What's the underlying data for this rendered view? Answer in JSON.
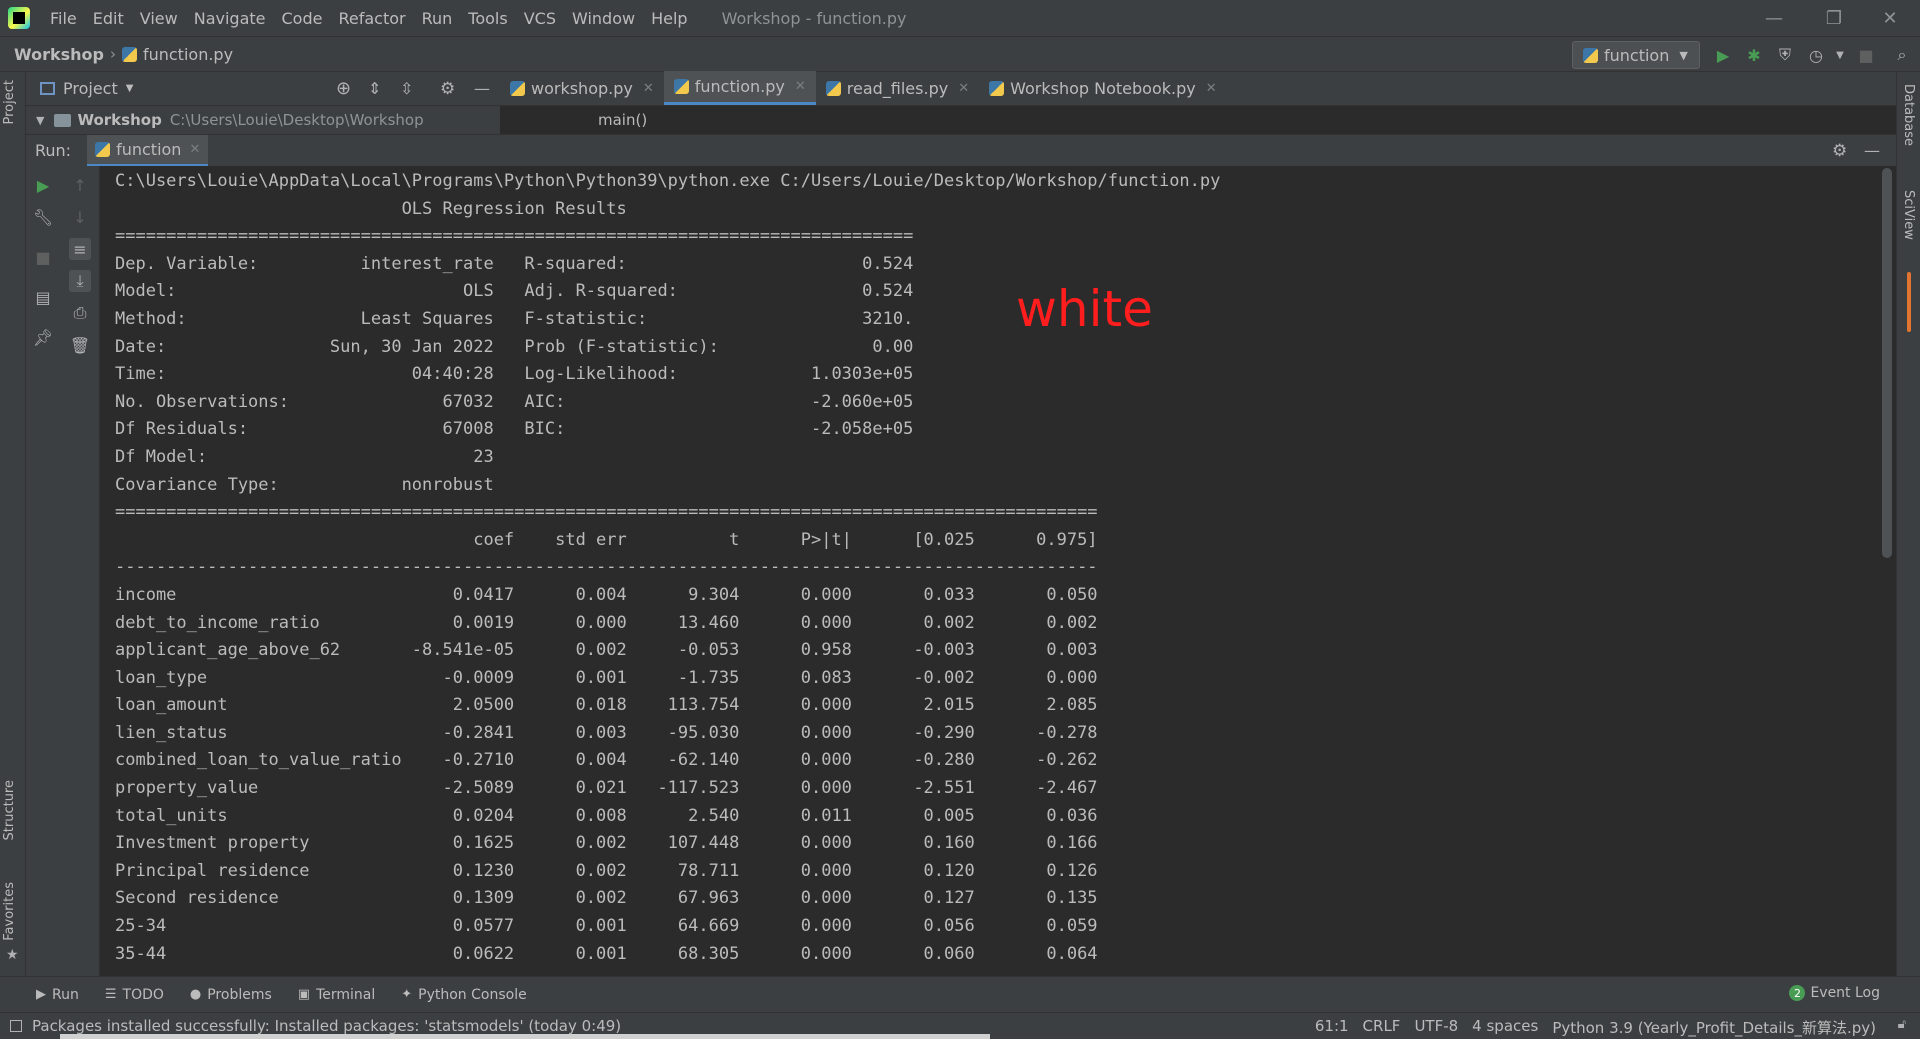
{
  "menu": {
    "items": [
      "File",
      "Edit",
      "View",
      "Navigate",
      "Code",
      "Refactor",
      "Run",
      "Tools",
      "VCS",
      "Window",
      "Help"
    ],
    "window_title": "Workshop - function.py"
  },
  "navbar": {
    "project": "Workshop",
    "file": "function.py",
    "run_config": "function"
  },
  "project_panel": {
    "title": "Project",
    "root_name": "Workshop",
    "root_path": "C:\\Users\\Louie\\Desktop\\Workshop"
  },
  "editor": {
    "tabs": [
      {
        "label": "workshop.py",
        "active": false
      },
      {
        "label": "function.py",
        "active": true
      },
      {
        "label": "read_files.py",
        "active": false
      },
      {
        "label": "Workshop Notebook.py",
        "active": false
      }
    ],
    "breadcrumb": "main()"
  },
  "run_panel": {
    "label": "Run:",
    "tab": "function"
  },
  "console": {
    "command": "C:\\Users\\Louie\\AppData\\Local\\Programs\\Python\\Python39\\python.exe C:/Users/Louie/Desktop/Workshop/function.py",
    "output": "                            OLS Regression Results                            \n==============================================================================\nDep. Variable:          interest_rate   R-squared:                       0.524\nModel:                            OLS   Adj. R-squared:                  0.524\nMethod:                 Least Squares   F-statistic:                     3210.\nDate:                Sun, 30 Jan 2022   Prob (F-statistic):               0.00\nTime:                        04:40:28   Log-Likelihood:             1.0303e+05\nNo. Observations:               67032   AIC:                        -2.060e+05\nDf Residuals:                   67008   BIC:                        -2.058e+05\nDf Model:                          23                                         \nCovariance Type:            nonrobust                                         \n================================================================================================\n                                   coef    std err          t      P>|t|      [0.025      0.975]\n------------------------------------------------------------------------------------------------\nincome                           0.0417      0.004      9.304      0.000       0.033       0.050\ndebt_to_income_ratio             0.0019      0.000     13.460      0.000       0.002       0.002\napplicant_age_above_62       -8.541e-05      0.002     -0.053      0.958      -0.003       0.003\nloan_type                       -0.0009      0.001     -1.735      0.083      -0.002       0.000\nloan_amount                      2.0500      0.018    113.754      0.000       2.015       2.085\nlien_status                     -0.2841      0.003    -95.030      0.000      -0.290      -0.278\ncombined_loan_to_value_ratio    -0.2710      0.004    -62.140      0.000      -0.280      -0.262\nproperty_value                  -2.5089      0.021   -117.523      0.000      -2.551      -2.467\ntotal_units                      0.0204      0.008      2.540      0.011       0.005       0.036\nInvestment property              0.1625      0.002    107.448      0.000       0.160       0.166\nPrincipal residence              0.1230      0.002     78.711      0.000       0.120       0.126\nSecond residence                 0.1309      0.002     67.963      0.000       0.127       0.135\n25-34                            0.0577      0.001     64.669      0.000       0.056       0.059\n35-44                            0.0622      0.001     68.305      0.000       0.060       0.064",
    "annotation": "white"
  },
  "left_strip": {
    "project": "Project",
    "structure": "Structure",
    "favorites": "Favorites"
  },
  "right_strip": {
    "database": "Database",
    "sciview": "SciView"
  },
  "bottom_tabs": [
    {
      "label": "Run",
      "icon": "play-icon"
    },
    {
      "label": "TODO",
      "icon": "list-icon"
    },
    {
      "label": "Problems",
      "icon": "info-icon"
    },
    {
      "label": "Terminal",
      "icon": "terminal-icon"
    },
    {
      "label": "Python Console",
      "icon": "python-icon"
    }
  ],
  "event_log": {
    "count": "2",
    "label": "Event Log"
  },
  "status": {
    "message": "Packages installed successfully: Installed packages: 'statsmodels' (today 0:49)",
    "position": "61:1",
    "line_sep": "CRLF",
    "encoding": "UTF-8",
    "indent": "4 spaces",
    "interpreter": "Python 3.9 (Yearly_Profit_Details_新算法.py)"
  },
  "colors": {
    "accent": "#4a88c7",
    "annotation": "#ff1d1d",
    "run_green": "#499c54"
  }
}
